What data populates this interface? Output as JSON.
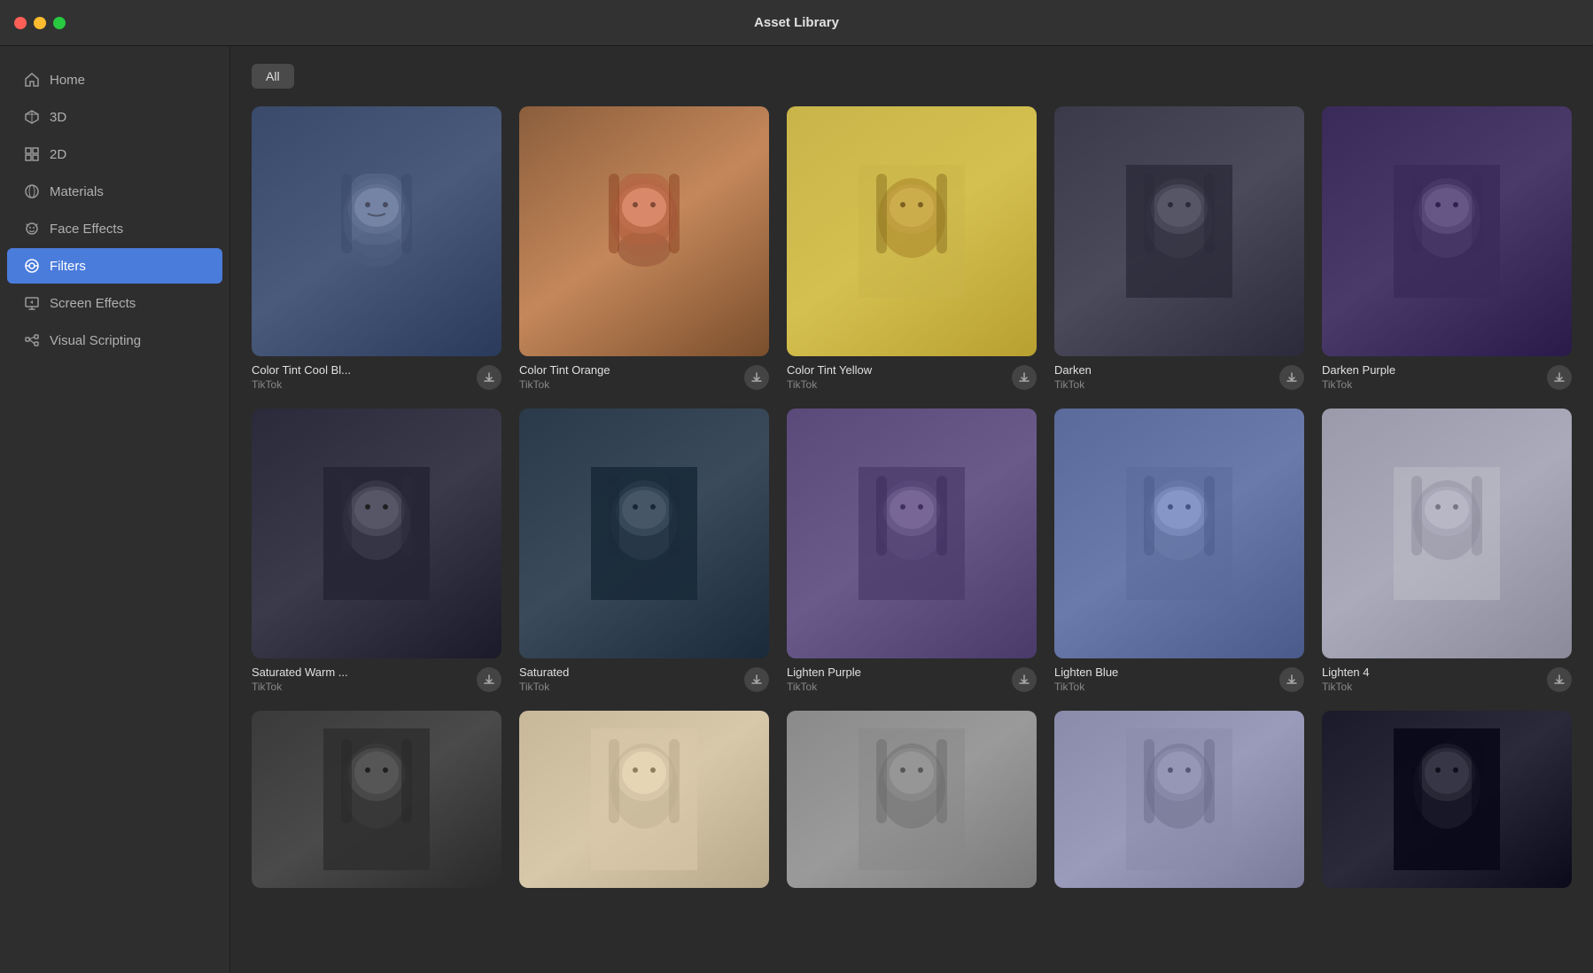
{
  "window": {
    "title": "Asset Library"
  },
  "sidebar": {
    "items": [
      {
        "id": "home",
        "label": "Home",
        "icon": "home",
        "active": false
      },
      {
        "id": "3d",
        "label": "3D",
        "icon": "cube",
        "active": false
      },
      {
        "id": "2d",
        "label": "2D",
        "icon": "2d-grid",
        "active": false
      },
      {
        "id": "materials",
        "label": "Materials",
        "icon": "circle",
        "active": false
      },
      {
        "id": "face-effects",
        "label": "Face Effects",
        "icon": "face",
        "active": false
      },
      {
        "id": "filters",
        "label": "Filters",
        "icon": "filter",
        "active": true
      },
      {
        "id": "screen-effects",
        "label": "Screen Effects",
        "icon": "screen",
        "active": false
      },
      {
        "id": "visual-scripting",
        "label": "Visual Scripting",
        "icon": "script",
        "active": false
      }
    ]
  },
  "filter_bar": {
    "buttons": [
      {
        "id": "all",
        "label": "All"
      }
    ]
  },
  "assets": {
    "rows": [
      [
        {
          "id": "1",
          "name": "Color Tint Cool Bl...",
          "source": "TikTok",
          "thumb_class": "thumb-cool-blue"
        },
        {
          "id": "2",
          "name": "Color Tint Orange",
          "source": "TikTok",
          "thumb_class": "thumb-orange"
        },
        {
          "id": "3",
          "name": "Color Tint Yellow",
          "source": "TikTok",
          "thumb_class": "thumb-yellow"
        },
        {
          "id": "4",
          "name": "Darken",
          "source": "TikTok",
          "thumb_class": "thumb-dark"
        },
        {
          "id": "5",
          "name": "Darken Purple",
          "source": "TikTok",
          "thumb_class": "thumb-purple"
        }
      ],
      [
        {
          "id": "6",
          "name": "Saturated Warm ...",
          "source": "TikTok",
          "thumb_class": "thumb-warm"
        },
        {
          "id": "7",
          "name": "Saturated",
          "source": "TikTok",
          "thumb_class": "thumb-saturated"
        },
        {
          "id": "8",
          "name": "Lighten Purple",
          "source": "TikTok",
          "thumb_class": "thumb-lighten-purple"
        },
        {
          "id": "9",
          "name": "Lighten Blue",
          "source": "TikTok",
          "thumb_class": "thumb-lighten-blue"
        },
        {
          "id": "10",
          "name": "Lighten 4",
          "source": "TikTok",
          "thumb_class": "thumb-lighten4"
        }
      ],
      [
        {
          "id": "11",
          "name": "",
          "source": "",
          "thumb_class": "thumb-row3-1"
        },
        {
          "id": "12",
          "name": "",
          "source": "",
          "thumb_class": "thumb-row3-2"
        },
        {
          "id": "13",
          "name": "",
          "source": "",
          "thumb_class": "thumb-row3-3"
        },
        {
          "id": "14",
          "name": "",
          "source": "",
          "thumb_class": "thumb-row3-4"
        },
        {
          "id": "15",
          "name": "",
          "source": "",
          "thumb_class": "thumb-row3-5"
        }
      ]
    ],
    "download_label": "⬇"
  }
}
